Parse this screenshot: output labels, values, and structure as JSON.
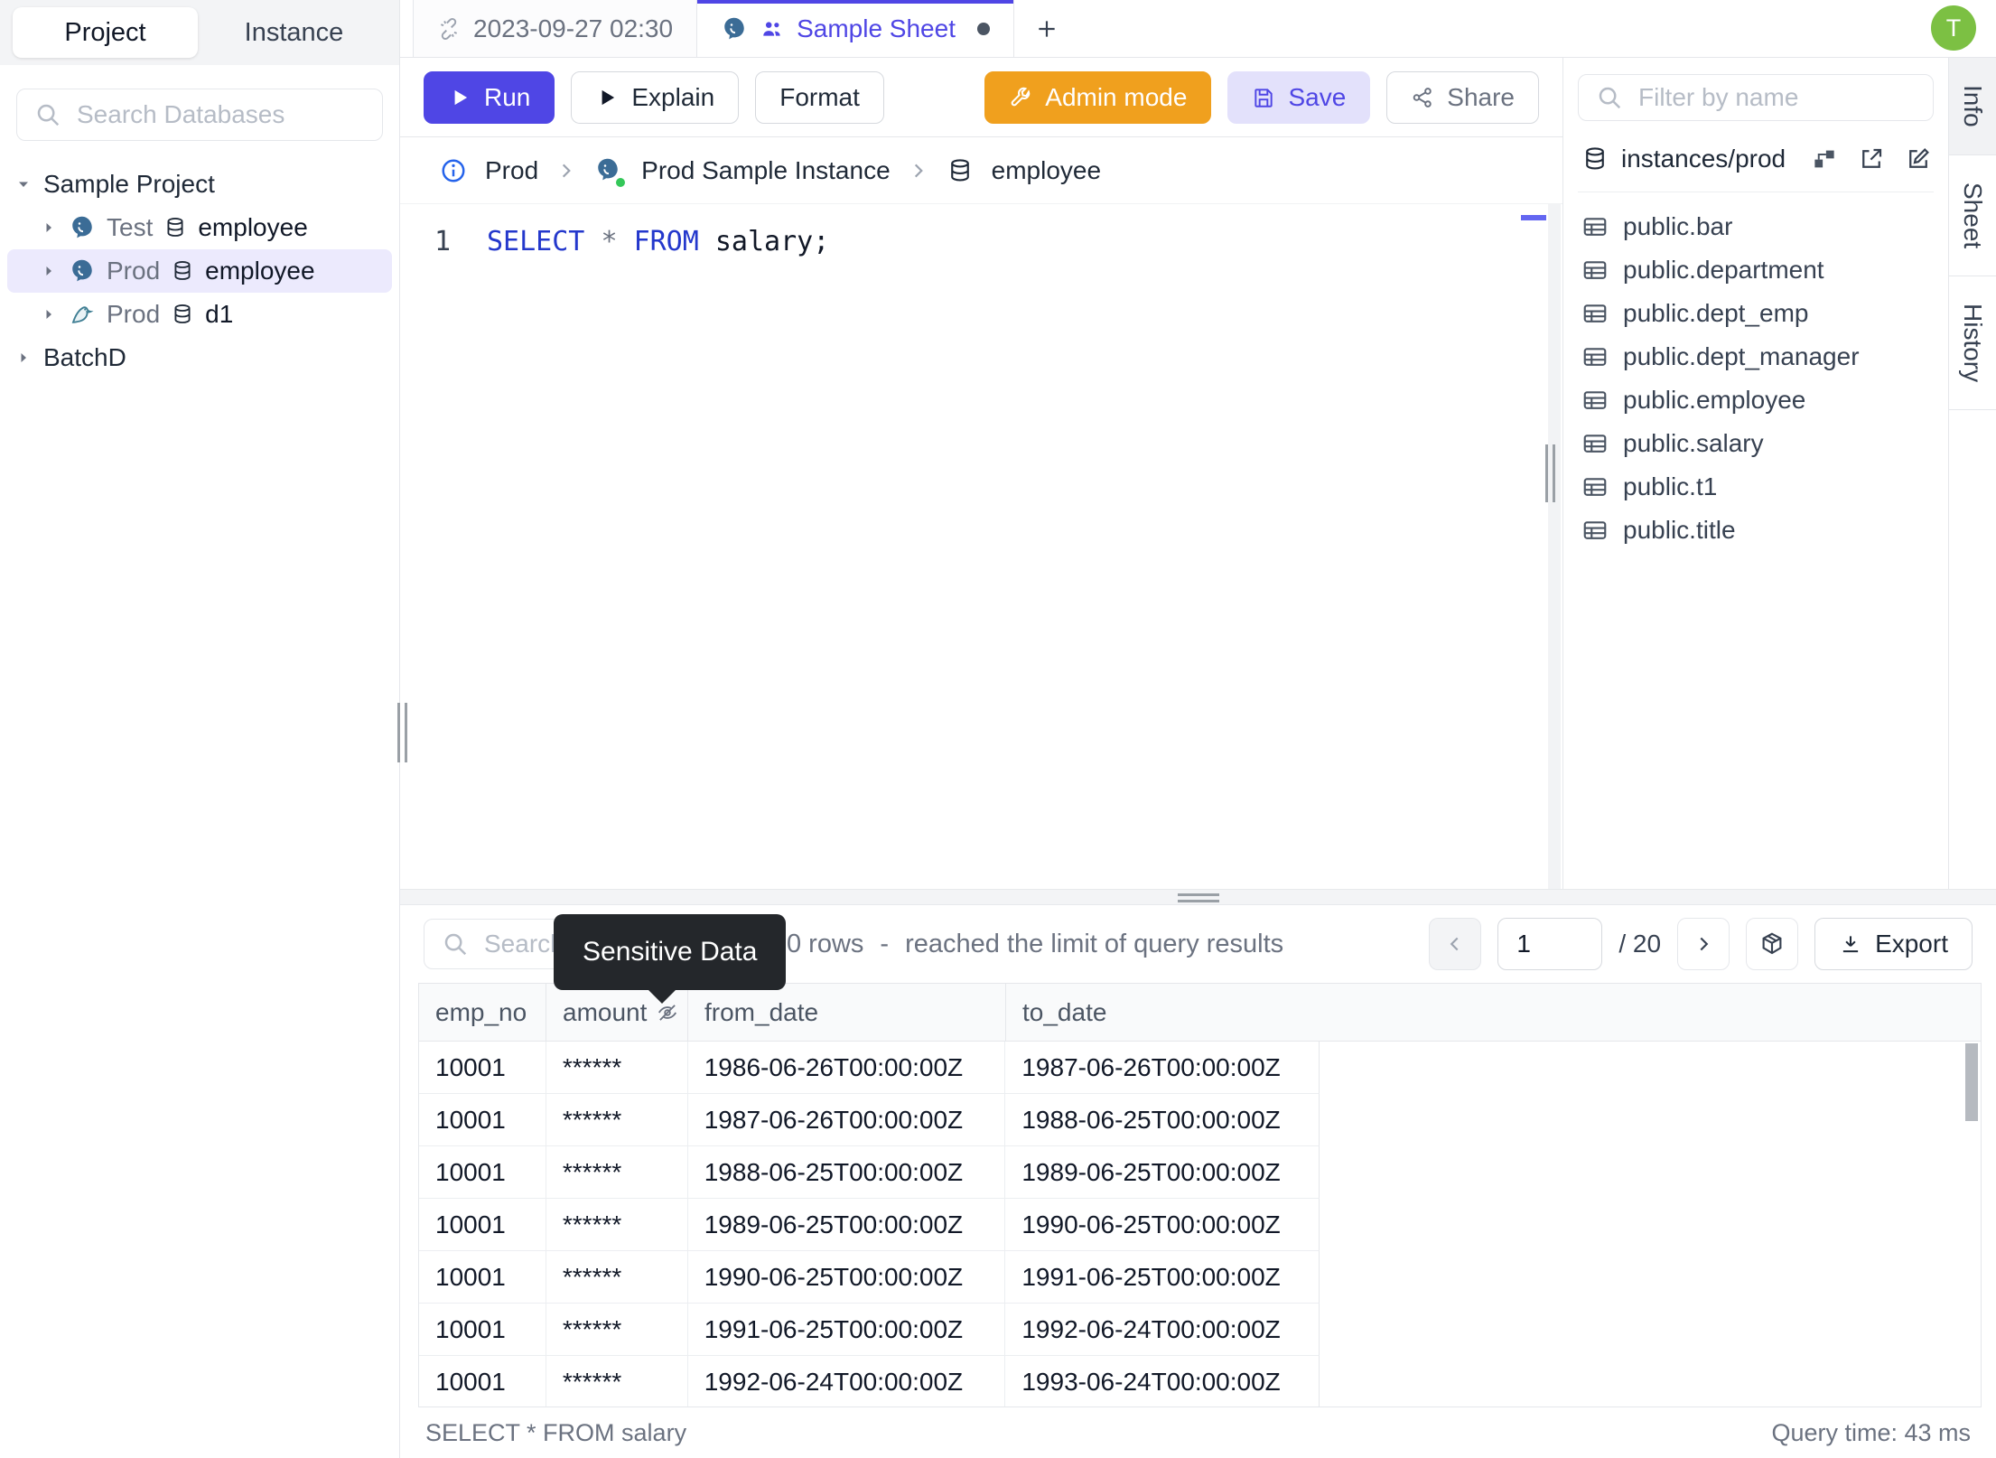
{
  "left_sidebar": {
    "tabs": [
      {
        "label": "Project"
      },
      {
        "label": "Instance"
      }
    ],
    "search_placeholder": "Search Databases",
    "tree": {
      "root": "Sample Project",
      "items": [
        {
          "env": "Test",
          "db": "employee",
          "engine": "postgres"
        },
        {
          "env": "Prod",
          "db": "employee",
          "engine": "postgres"
        },
        {
          "env": "Prod",
          "db": "d1",
          "engine": "mysql"
        }
      ],
      "batch": "BatchD"
    }
  },
  "tabbar": {
    "recent_tab": "2023-09-27 02:30",
    "active_tab": "Sample Sheet",
    "new_tab": "+",
    "avatar_initial": "T"
  },
  "toolbar": {
    "run": "Run",
    "explain": "Explain",
    "format": "Format",
    "admin_mode": "Admin mode",
    "save": "Save",
    "share": "Share"
  },
  "breadcrumb": {
    "environment": "Prod",
    "instance": "Prod Sample Instance",
    "database": "employee"
  },
  "editor": {
    "line_number": "1",
    "keyword_select": "SELECT",
    "operator_star": "*",
    "keyword_from": "FROM",
    "identifier": "salary;"
  },
  "right_sidebar": {
    "filter_placeholder": "Filter by name",
    "schema_path": "instances/prod",
    "tables": [
      "public.bar",
      "public.department",
      "public.dept_emp",
      "public.dept_manager",
      "public.employee",
      "public.salary",
      "public.t1",
      "public.title"
    ],
    "side_tabs": [
      {
        "label": "Info"
      },
      {
        "label": "Sheet"
      },
      {
        "label": "History"
      }
    ]
  },
  "results": {
    "search_placeholder": "Search",
    "tooltip": "Sensitive Data",
    "row_count": "0 rows",
    "separator": "-",
    "limit_note": "reached the limit of query results",
    "pager": {
      "page": "1",
      "total": "/ 20"
    },
    "export_label": "Export",
    "table": {
      "headers": [
        {
          "label": "emp_no"
        },
        {
          "label": "amount",
          "masked": true
        },
        {
          "label": "from_date"
        },
        {
          "label": "to_date"
        }
      ],
      "rows": [
        [
          "10001",
          "******",
          "1986-06-26T00:00:00Z",
          "1987-06-26T00:00:00Z"
        ],
        [
          "10001",
          "******",
          "1987-06-26T00:00:00Z",
          "1988-06-25T00:00:00Z"
        ],
        [
          "10001",
          "******",
          "1988-06-25T00:00:00Z",
          "1989-06-25T00:00:00Z"
        ],
        [
          "10001",
          "******",
          "1989-06-25T00:00:00Z",
          "1990-06-25T00:00:00Z"
        ],
        [
          "10001",
          "******",
          "1990-06-25T00:00:00Z",
          "1991-06-25T00:00:00Z"
        ],
        [
          "10001",
          "******",
          "1991-06-25T00:00:00Z",
          "1992-06-24T00:00:00Z"
        ],
        [
          "10001",
          "******",
          "1992-06-24T00:00:00Z",
          "1993-06-24T00:00:00Z"
        ]
      ]
    },
    "status": {
      "left": "SELECT * FROM salary",
      "right": "Query time: 43 ms"
    }
  },
  "colors": {
    "accent": "#4f46e5",
    "admin_orange": "#f0a01e",
    "avatar_green": "#7cc043",
    "keyword_blue": "#2438cc",
    "status_green": "#34c759"
  }
}
